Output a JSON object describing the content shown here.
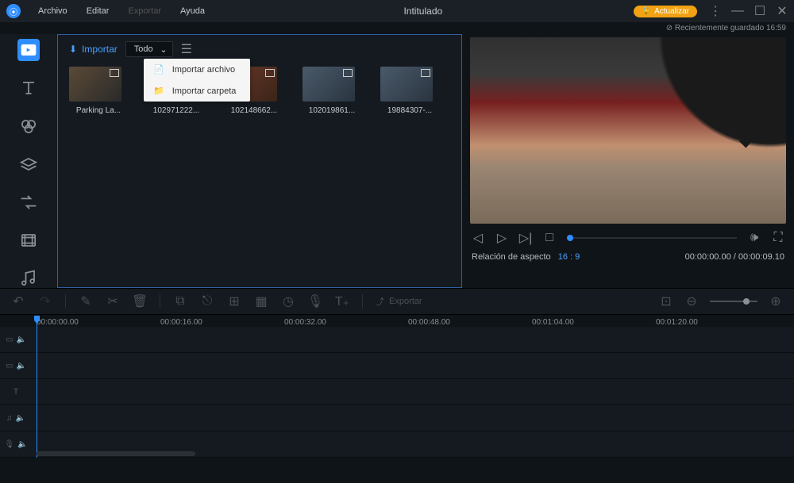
{
  "menu": {
    "archivo": "Archivo",
    "editar": "Editar",
    "exportar": "Exportar",
    "ayuda": "Ayuda"
  },
  "title": "Intitulado",
  "update": "Actualizar",
  "saved": "Recientemente guardado 16:59",
  "mediaHeader": {
    "importar": "Importar",
    "filter": "Todo"
  },
  "importMenu": {
    "file": "Importar archivo",
    "folder": "Importar carpeta"
  },
  "thumbs": [
    "Parking La...",
    "102971222...",
    "102148662...",
    "102019861...",
    "19884307-..."
  ],
  "preview": {
    "aspectLabel": "Relación de aspecto",
    "aspectVal": "16 : 9",
    "time": "00:00:00.00 / 00:00:09.10"
  },
  "toolbar": {
    "exportar": "Exportar"
  },
  "ruler": [
    "00:00:00.00",
    "00:00:16.00",
    "00:00:32.00",
    "00:00:48.00",
    "00:01:04.00",
    "00:01:20.00"
  ]
}
